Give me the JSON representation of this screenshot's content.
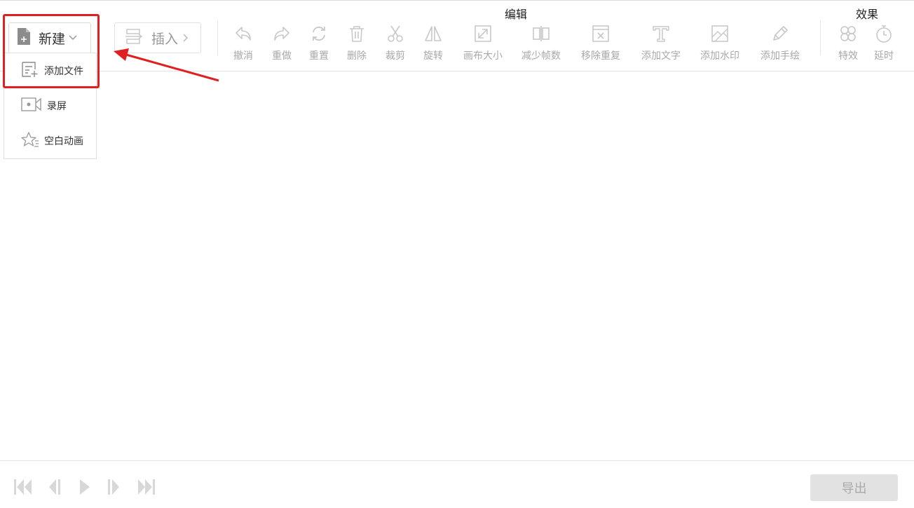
{
  "toolbar": {
    "new_label": "新建",
    "insert_label": "插入",
    "group_edit": "编辑",
    "group_effects": "效果",
    "tools": {
      "undo": "撤消",
      "redo": "重做",
      "reset": "重置",
      "delete": "删除",
      "crop": "裁剪",
      "rotate": "旋转",
      "canvas_size": "画布大小",
      "reduce_frames": "减少帧数",
      "remove_duplicates": "移除重复",
      "add_text": "添加文字",
      "add_watermark": "添加水印",
      "add_drawing": "添加手绘",
      "effects": "特效",
      "delay": "延时"
    }
  },
  "dropdown": {
    "add_file": "添加文件",
    "record_screen": "录屏",
    "blank_animation": "空白动画"
  },
  "bottom": {
    "export_label": "导出"
  },
  "colors": {
    "highlight": "#e02020",
    "disabled_icon": "#c8c8c8",
    "disabled_text": "#a8a8a8"
  }
}
